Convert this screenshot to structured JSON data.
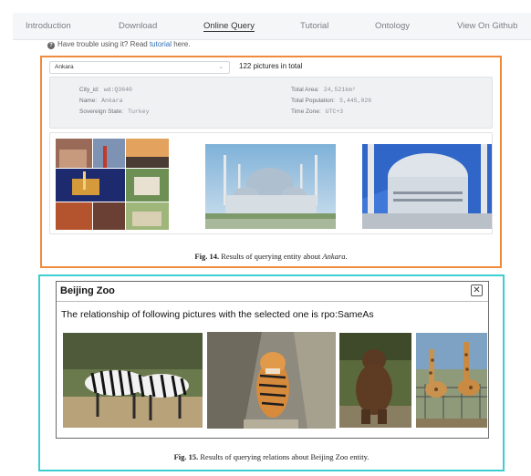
{
  "nav": {
    "items": [
      {
        "label": "Introduction",
        "active": false
      },
      {
        "label": "Download",
        "active": false
      },
      {
        "label": "Online Query",
        "active": true
      },
      {
        "label": "Tutorial",
        "active": false
      },
      {
        "label": "Ontology",
        "active": false
      },
      {
        "label": "View On Github",
        "active": false
      }
    ]
  },
  "help": {
    "prefix": "Have trouble using it? Read ",
    "link": "tutorial",
    "suffix": " here."
  },
  "figure14": {
    "select_value": "Ankara",
    "picture_count": "122 pictures in total",
    "info_left": [
      {
        "key": "City_id:",
        "value": "wd:Q3640"
      },
      {
        "key": "Name:",
        "value": "Ankara"
      },
      {
        "key": "Sovereign State:",
        "value": "Turkey"
      }
    ],
    "info_right": [
      {
        "key": "Total Area:",
        "value": "24,521km²"
      },
      {
        "key": "Total Population:",
        "value": "5,445,026"
      },
      {
        "key": "Time Zone:",
        "value": "UTC+3"
      }
    ],
    "caption_label": "Fig. 14.",
    "caption_text": " Results of querying entity about ",
    "caption_entity": "Ankara",
    "caption_end": "."
  },
  "figure15": {
    "dialog_title": "Beijing Zoo",
    "close_glyph": "✕",
    "relationship_text": "The relationship of following pictures with the selected one is rpo:SameAs",
    "caption_label": "Fig. 15.",
    "caption_text": " Results of querying relations about Beijing Zoo entity."
  },
  "colors": {
    "fig14_border": "#f08a3c",
    "fig15_border": "#3ecdd0",
    "link": "#2e6db4"
  }
}
